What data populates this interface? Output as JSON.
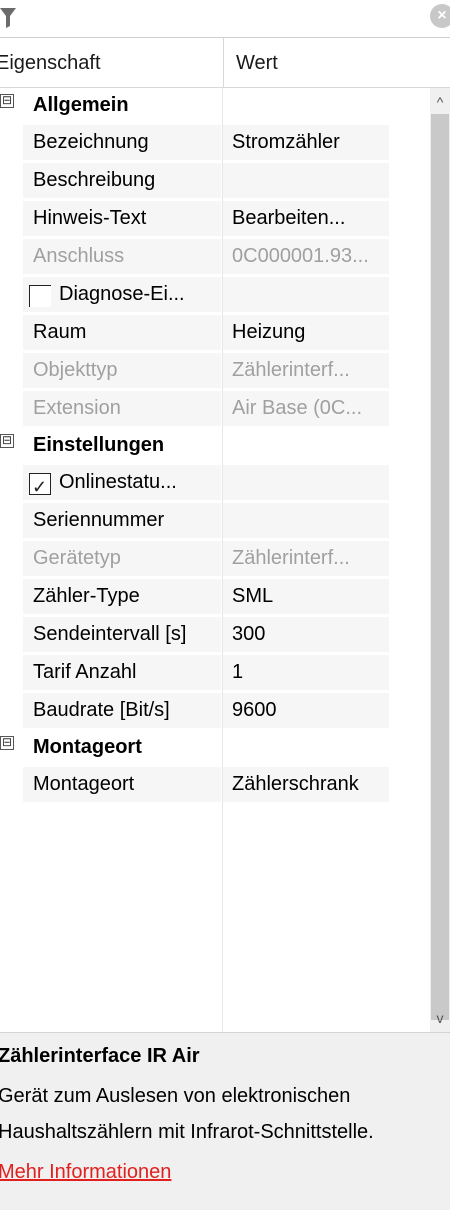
{
  "toolbar": {
    "filter_icon": "filter-icon",
    "close_icon": "close-icon"
  },
  "header": {
    "property": "Eigenschaft",
    "value": "Wert"
  },
  "categories": [
    {
      "name": "Allgemein",
      "expander": "⊟"
    },
    {
      "name": "Einstellungen",
      "expander": "⊟"
    },
    {
      "name": "Montageort",
      "expander": "⊟"
    }
  ],
  "props": {
    "bezeichnung": {
      "label": "Bezeichnung",
      "value": "Stromzähler"
    },
    "beschreibung": {
      "label": "Beschreibung",
      "value": ""
    },
    "hinweis": {
      "label": "Hinweis-Text",
      "value": "Bearbeiten..."
    },
    "anschluss": {
      "label": "Anschluss",
      "value": "0C000001.93..."
    },
    "diagnose": {
      "label": "Diagnose-Ei...",
      "checked": false
    },
    "raum": {
      "label": "Raum",
      "value": "Heizung"
    },
    "objekttyp": {
      "label": "Objekttyp",
      "value": "Zählerinterf..."
    },
    "extension": {
      "label": "Extension",
      "value": "Air Base (0C..."
    },
    "onlinestatus": {
      "label": "Onlinestatu...",
      "checked": true
    },
    "seriennummer": {
      "label": "Seriennummer",
      "value": ""
    },
    "geraetetyp": {
      "label": "Gerätetyp",
      "value": "Zählerinterf..."
    },
    "zaehlertype": {
      "label": "Zähler-Type",
      "value": "SML"
    },
    "sendeintervall": {
      "label": "Sendeintervall [s]",
      "value": "300"
    },
    "tarif": {
      "label": "Tarif Anzahl",
      "value": "1"
    },
    "baudrate": {
      "label": "Baudrate [Bit/s]",
      "value": "9600"
    },
    "montageort": {
      "label": "Montageort",
      "value": "Zählerschrank"
    }
  },
  "scrollbar": {
    "up": "^",
    "down": "v"
  },
  "description": {
    "title": "Zählerinterface IR Air",
    "line1": "Gerät zum Auslesen von elektronischen",
    "line2": "Haushaltszählern mit Infrarot-Schnittstelle.",
    "link": "Mehr Informationen"
  },
  "colors": {
    "link": "#e0211f",
    "readonly_text": "#a0a0a0",
    "row_bg": "#f6f6f6"
  }
}
